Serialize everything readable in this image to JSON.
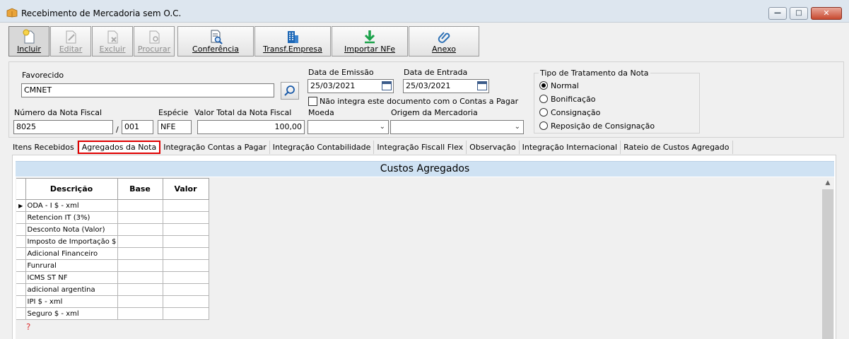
{
  "window": {
    "title": "Recebimento de Mercadoria sem O.C.",
    "controls": {
      "minimize": "—",
      "maximize": "□",
      "close": "✕"
    }
  },
  "toolbar": {
    "buttons": [
      {
        "label": "Incluir",
        "icon": "new-document-icon",
        "state": "pressed"
      },
      {
        "label": "Editar",
        "icon": "edit-document-icon",
        "state": "disabled"
      },
      {
        "label": "Excluir",
        "icon": "delete-document-icon",
        "state": "disabled"
      },
      {
        "label": "Procurar",
        "icon": "search-document-icon",
        "state": "disabled"
      },
      {
        "label": "Conferência",
        "icon": "document-magnifier-icon",
        "state": "enabled"
      },
      {
        "label": "Transf.Empresa",
        "icon": "building-icon",
        "state": "enabled"
      },
      {
        "label": "Importar NFe",
        "icon": "download-arrow-icon",
        "state": "enabled"
      },
      {
        "label": "Anexo",
        "icon": "paperclip-icon",
        "state": "enabled"
      }
    ]
  },
  "form": {
    "favorecido_label": "Favorecido",
    "favorecido_value": "CMNET",
    "data_emissao_label": "Data de Emissão",
    "data_emissao_value": "25/03/2021",
    "data_entrada_label": "Data de Entrada",
    "data_entrada_value": "25/03/2021",
    "nao_integra_label": "Não integra este documento com o Contas a Pagar",
    "numero_nf_label": "Número da Nota Fiscal",
    "numero_nf_value": "8025",
    "serie_separator": "/",
    "serie_value": "001",
    "especie_label": "Espécie",
    "especie_value": "NFE",
    "valor_total_label": "Valor Total da Nota Fiscal",
    "valor_total_value": "100,00",
    "moeda_label": "Moeda",
    "moeda_value": "",
    "origem_label": "Origem da Mercadoria",
    "origem_value": ""
  },
  "tratamento": {
    "title": "Tipo de Tratamento da Nota",
    "options": [
      "Normal",
      "Bonificação",
      "Consignação",
      "Reposição de Consignação"
    ],
    "selected": "Normal"
  },
  "tabs": [
    "Itens Recebidos",
    "Agregados da Nota",
    "Integração Contas a Pagar",
    "Integração Contabilidade",
    "Integração Fiscall Flex",
    "Observação",
    "Integração Internacional",
    "Rateio de Custos Agregado"
  ],
  "active_tab": "Agregados da Nota",
  "custos": {
    "title": "Custos Agregados",
    "columns": [
      "Descrição",
      "Base",
      "Valor"
    ],
    "rows": [
      {
        "descricao": "ODA - I $ - xml",
        "base": "",
        "valor": ""
      },
      {
        "descricao": "Retencion IT (3%)",
        "base": "",
        "valor": ""
      },
      {
        "descricao": "Desconto Nota (Valor)",
        "base": "",
        "valor": ""
      },
      {
        "descricao": "Imposto de Importação $ - xml",
        "base": "",
        "valor": ""
      },
      {
        "descricao": "Adicional Financeiro",
        "base": "",
        "valor": ""
      },
      {
        "descricao": "Funrural",
        "base": "",
        "valor": ""
      },
      {
        "descricao": "ICMS ST NF",
        "base": "",
        "valor": ""
      },
      {
        "descricao": "adicional argentina",
        "base": "",
        "valor": ""
      },
      {
        "descricao": "IPI $ - xml",
        "base": "",
        "valor": ""
      },
      {
        "descricao": "Seguro $ - xml",
        "base": "",
        "valor": ""
      }
    ],
    "current_row_marker": "▶",
    "new_row_marker": "?"
  },
  "colors": {
    "title_bar": "#dde6ef",
    "section_header": "#cfe2f3",
    "active_tab_border": "#e00000"
  }
}
